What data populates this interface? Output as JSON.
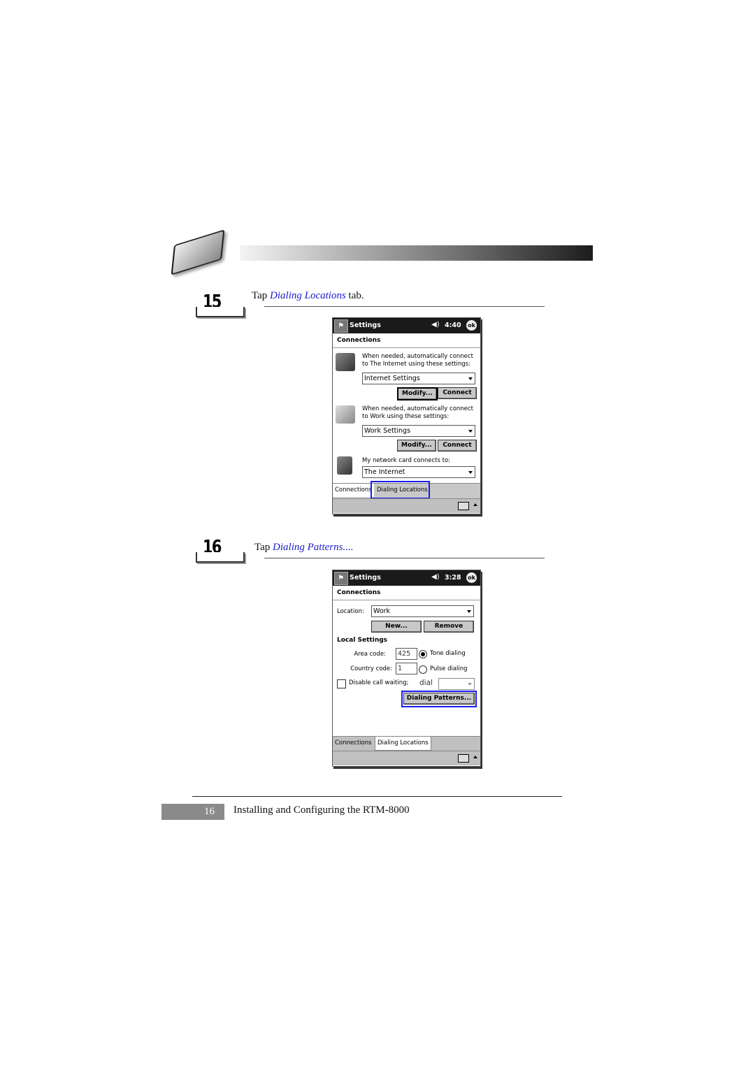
{
  "header": {
    "icon": "handheld-device-icon"
  },
  "steps": [
    {
      "number": "15",
      "text_before": "Tap ",
      "link": "Dialing Locations",
      "text_after": " tab."
    },
    {
      "number": "16",
      "text_before": "Tap ",
      "link": "Dialing Patterns....",
      "text_after": ""
    }
  ],
  "screen1": {
    "title": "Settings",
    "time": "4:40",
    "ok": "ok",
    "section": "Connections",
    "internet_text": "When needed, automatically connect to The Internet using these settings:",
    "internet_select": "Internet Settings",
    "work_text": "When needed, automatically connect to Work using these settings:",
    "work_select": "Work Settings",
    "modify": "Modify...",
    "connect": "Connect",
    "network_text": "My network card connects to:",
    "network_select": "The Internet",
    "tabs": [
      "Connections",
      "Dialing Locations"
    ]
  },
  "screen2": {
    "title": "Settings",
    "time": "3:28",
    "ok": "ok",
    "section": "Connections",
    "location_label": "Location:",
    "location_value": "Work",
    "new": "New...",
    "remove": "Remove",
    "local_settings": "Local Settings",
    "area_code_label": "Area code:",
    "area_code": "425",
    "country_code_label": "Country code:",
    "country_code": "1",
    "tone": "Tone dialing",
    "pulse": "Pulse dialing",
    "disable_call_waiting": "Disable call waiting;",
    "dial": "dial",
    "dialing_patterns": "Dialing Patterns...",
    "tabs": [
      "Connections",
      "Dialing Locations"
    ]
  },
  "footer": {
    "page_number": "16",
    "title": "Installing and Configuring the RTM-8000"
  },
  "colors": {
    "link": "#1a1acc",
    "highlight": "#1a1aee"
  }
}
